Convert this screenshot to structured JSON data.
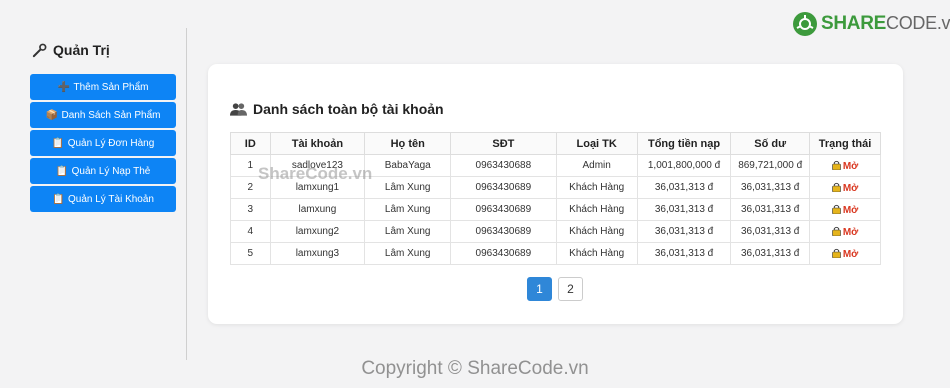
{
  "brand": {
    "logo_primary": "SHARE",
    "logo_secondary": "CODE.vn",
    "primary_color": "#3c9a3c"
  },
  "sidebar": {
    "title": "Quản Trị",
    "title_icon": "wrench-icon",
    "items": [
      {
        "label": "Thêm Sản Phẩm",
        "icon": "plus-icon",
        "glyph": "➕"
      },
      {
        "label": "Danh Sách Sản Phẩm",
        "icon": "box-icon",
        "glyph": "📦"
      },
      {
        "label": "Quản Lý Đơn Hàng",
        "icon": "clipboard-icon",
        "glyph": "📋"
      },
      {
        "label": "Quản Lý Nạp Thẻ",
        "icon": "clipboard-icon",
        "glyph": "📋"
      },
      {
        "label": "Quản Lý Tài Khoản",
        "icon": "clipboard-icon",
        "glyph": "📋"
      }
    ],
    "accent_color": "#0d84f5"
  },
  "main": {
    "title": "Danh sách toàn bộ tài khoản",
    "title_icon": "users-icon",
    "table": {
      "headers": [
        "ID",
        "Tài khoản",
        "Họ tên",
        "SĐT",
        "Loại TK",
        "Tổng tiền nạp",
        "Số dư",
        "Trạng thái"
      ],
      "rows": [
        [
          "1",
          "sadlove123",
          "BabaYaga",
          "0963430688",
          "Admin",
          "1,001,800,000 đ",
          "869,721,000 đ",
          "Mở"
        ],
        [
          "2",
          "lamxung1",
          "Lâm Xung",
          "0963430689",
          "Khách Hàng",
          "36,031,313 đ",
          "36,031,313 đ",
          "Mở"
        ],
        [
          "3",
          "lamxung",
          "Lâm Xung",
          "0963430689",
          "Khách Hàng",
          "36,031,313 đ",
          "36,031,313 đ",
          "Mở"
        ],
        [
          "4",
          "lamxung2",
          "Lâm Xung",
          "0963430689",
          "Khách Hàng",
          "36,031,313 đ",
          "36,031,313 đ",
          "Mở"
        ],
        [
          "5",
          "lamxung3",
          "Lâm Xung",
          "0963430689",
          "Khách Hàng",
          "36,031,313 đ",
          "36,031,313 đ",
          "Mở"
        ]
      ],
      "status_color": "#d9361f"
    },
    "pagination": {
      "pages": [
        "1",
        "2"
      ],
      "active": "1"
    }
  },
  "watermark": "ShareCode.vn",
  "copyright": "Copyright © ShareCode.vn"
}
